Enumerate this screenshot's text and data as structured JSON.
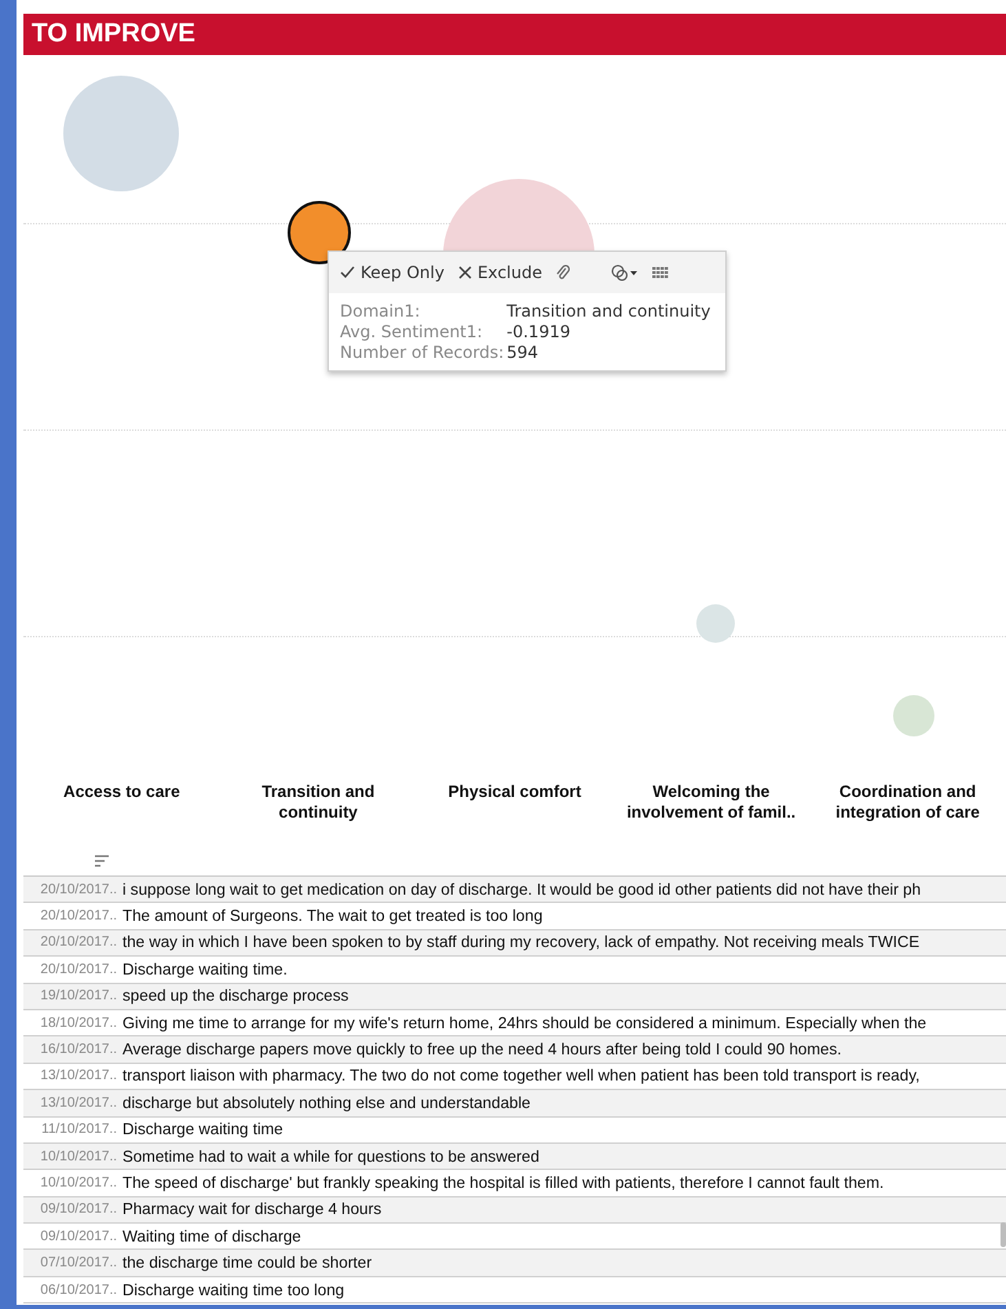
{
  "header": {
    "title": "TO IMPROVE"
  },
  "bubbles": [
    {
      "color": "#d3dde6",
      "selected": false
    },
    {
      "color": "#f28e2b",
      "selected": true
    },
    {
      "color": "#f2d4d8",
      "selected": false
    },
    {
      "color": "#dbe5e6",
      "selected": false
    },
    {
      "color": "#d8e6d5",
      "selected": false
    }
  ],
  "tooltip": {
    "actions": [
      {
        "kind": "keep",
        "label": "Keep Only"
      },
      {
        "kind": "exclude",
        "label": "Exclude"
      },
      {
        "kind": "attach"
      },
      {
        "kind": "group"
      },
      {
        "kind": "view-data"
      }
    ],
    "fields": [
      {
        "label": "Domain1:",
        "value": "Transition and continuity"
      },
      {
        "label": "Avg. Sentiment1:",
        "value": "-0.1919"
      },
      {
        "label": "Number of Records:",
        "value": "594"
      }
    ]
  },
  "categories": [
    "Access to care",
    "Transition and continuity",
    "Physical comfort",
    "Welcoming the involvement of famil..",
    "Coordination and integration of care"
  ],
  "table": {
    "rows": [
      {
        "date": "20/10/2017..",
        "comment": "i suppose long wait to get medication on day of discharge. It would be good id other patients did not have their ph"
      },
      {
        "date": "20/10/2017..",
        "comment": "The amount of Surgeons. The wait to get treated is too long"
      },
      {
        "date": "20/10/2017..",
        "comment": "the way in which I have been spoken to by staff during my recovery, lack of empathy. Not receiving meals TWICE"
      },
      {
        "date": "20/10/2017..",
        "comment": "Discharge waiting time."
      },
      {
        "date": "19/10/2017..",
        "comment": "speed up the discharge process"
      },
      {
        "date": "18/10/2017..",
        "comment": "Giving me time to arrange for my wife's return home, 24hrs should be considered a minimum. Especially when the"
      },
      {
        "date": "16/10/2017..",
        "comment": "Average discharge papers move quickly to free up the need 4 hours after being told I could 90 homes."
      },
      {
        "date": "13/10/2017..",
        "comment": "transport liaison with pharmacy. The two do not come together well when patient has been told transport is ready,"
      },
      {
        "date": "13/10/2017..",
        "comment": "discharge but absolutely nothing else and understandable"
      },
      {
        "date": "11/10/2017..",
        "comment": "Discharge waiting time"
      },
      {
        "date": "10/10/2017..",
        "comment": "Sometime had to wait a while for questions to be answered"
      },
      {
        "date": "10/10/2017..",
        "comment": "The speed of discharge' but frankly speaking the hospital is filled with patients, therefore I cannot fault them."
      },
      {
        "date": "09/10/2017..",
        "comment": "Pharmacy wait for discharge 4 hours"
      },
      {
        "date": "09/10/2017..",
        "comment": "Waiting time of discharge"
      },
      {
        "date": "07/10/2017..",
        "comment": "the discharge time could be shorter"
      },
      {
        "date": "06/10/2017..",
        "comment": "Discharge waiting time too long"
      }
    ]
  }
}
